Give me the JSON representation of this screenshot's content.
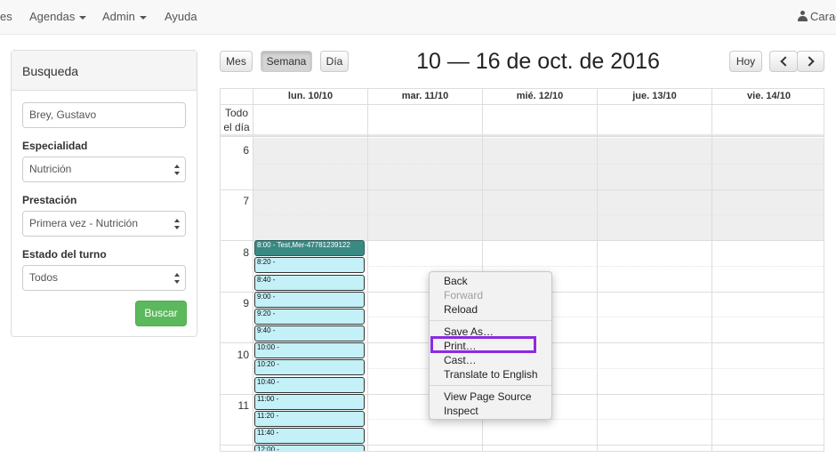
{
  "navbar": {
    "partial_left": "es",
    "agendas": "Agendas",
    "admin": "Admin",
    "ayuda": "Ayuda",
    "user": "Carac"
  },
  "search": {
    "title": "Busqueda",
    "name_value": "Brey, Gustavo",
    "especialidad_label": "Especialidad",
    "especialidad_value": "Nutrición",
    "prestacion_label": "Prestación",
    "prestacion_value": "Primera vez - Nutrición",
    "estado_label": "Estado del turno",
    "estado_value": "Todos",
    "buscar": "Buscar"
  },
  "calendar": {
    "views": [
      "Mes",
      "Semana",
      "Día"
    ],
    "active_view": "Semana",
    "title": "10 — 16 de oct. de 2016",
    "today": "Hoy",
    "columns": [
      "lun. 10/10",
      "mar. 11/10",
      "mié. 12/10",
      "jue. 13/10",
      "vie. 14/10"
    ],
    "allday": "Todo el día",
    "hours": [
      "6",
      "7",
      "8",
      "9",
      "10",
      "11"
    ],
    "events": [
      "8:00 - Test,Mer-47781239122",
      "8:20 -",
      "8:40 -",
      "9:00 -",
      "9:20 -",
      "9:40 -",
      "10:00 -",
      "10:20 -",
      "10:40 -",
      "11:00 -",
      "11:20 -",
      "11:40 -",
      "12:00 -"
    ]
  },
  "context_menu": {
    "items": [
      "Back",
      "Forward",
      "Reload",
      "Save As…",
      "Print…",
      "Cast…",
      "Translate to English",
      "View Page Source",
      "Inspect"
    ],
    "highlighted": "Print…"
  },
  "colors": {
    "success": "#5cb85c",
    "event": "#c4f0f7",
    "event_first": "#3a8a84",
    "highlight": "#8a2be2"
  }
}
